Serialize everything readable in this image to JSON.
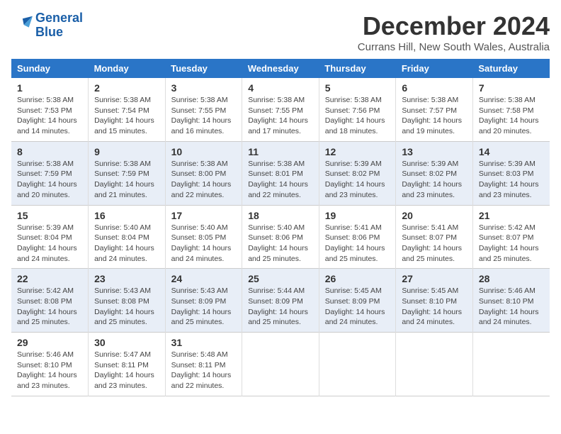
{
  "logo": {
    "line1": "General",
    "line2": "Blue"
  },
  "title": "December 2024",
  "location": "Currans Hill, New South Wales, Australia",
  "weekdays": [
    "Sunday",
    "Monday",
    "Tuesday",
    "Wednesday",
    "Thursday",
    "Friday",
    "Saturday"
  ],
  "weeks": [
    [
      {
        "day": "1",
        "sunrise": "5:38 AM",
        "sunset": "7:53 PM",
        "daylight": "14 hours and 14 minutes."
      },
      {
        "day": "2",
        "sunrise": "5:38 AM",
        "sunset": "7:54 PM",
        "daylight": "14 hours and 15 minutes."
      },
      {
        "day": "3",
        "sunrise": "5:38 AM",
        "sunset": "7:55 PM",
        "daylight": "14 hours and 16 minutes."
      },
      {
        "day": "4",
        "sunrise": "5:38 AM",
        "sunset": "7:55 PM",
        "daylight": "14 hours and 17 minutes."
      },
      {
        "day": "5",
        "sunrise": "5:38 AM",
        "sunset": "7:56 PM",
        "daylight": "14 hours and 18 minutes."
      },
      {
        "day": "6",
        "sunrise": "5:38 AM",
        "sunset": "7:57 PM",
        "daylight": "14 hours and 19 minutes."
      },
      {
        "day": "7",
        "sunrise": "5:38 AM",
        "sunset": "7:58 PM",
        "daylight": "14 hours and 20 minutes."
      }
    ],
    [
      {
        "day": "8",
        "sunrise": "5:38 AM",
        "sunset": "7:59 PM",
        "daylight": "14 hours and 20 minutes."
      },
      {
        "day": "9",
        "sunrise": "5:38 AM",
        "sunset": "7:59 PM",
        "daylight": "14 hours and 21 minutes."
      },
      {
        "day": "10",
        "sunrise": "5:38 AM",
        "sunset": "8:00 PM",
        "daylight": "14 hours and 22 minutes."
      },
      {
        "day": "11",
        "sunrise": "5:38 AM",
        "sunset": "8:01 PM",
        "daylight": "14 hours and 22 minutes."
      },
      {
        "day": "12",
        "sunrise": "5:39 AM",
        "sunset": "8:02 PM",
        "daylight": "14 hours and 23 minutes."
      },
      {
        "day": "13",
        "sunrise": "5:39 AM",
        "sunset": "8:02 PM",
        "daylight": "14 hours and 23 minutes."
      },
      {
        "day": "14",
        "sunrise": "5:39 AM",
        "sunset": "8:03 PM",
        "daylight": "14 hours and 23 minutes."
      }
    ],
    [
      {
        "day": "15",
        "sunrise": "5:39 AM",
        "sunset": "8:04 PM",
        "daylight": "14 hours and 24 minutes."
      },
      {
        "day": "16",
        "sunrise": "5:40 AM",
        "sunset": "8:04 PM",
        "daylight": "14 hours and 24 minutes."
      },
      {
        "day": "17",
        "sunrise": "5:40 AM",
        "sunset": "8:05 PM",
        "daylight": "14 hours and 24 minutes."
      },
      {
        "day": "18",
        "sunrise": "5:40 AM",
        "sunset": "8:06 PM",
        "daylight": "14 hours and 25 minutes."
      },
      {
        "day": "19",
        "sunrise": "5:41 AM",
        "sunset": "8:06 PM",
        "daylight": "14 hours and 25 minutes."
      },
      {
        "day": "20",
        "sunrise": "5:41 AM",
        "sunset": "8:07 PM",
        "daylight": "14 hours and 25 minutes."
      },
      {
        "day": "21",
        "sunrise": "5:42 AM",
        "sunset": "8:07 PM",
        "daylight": "14 hours and 25 minutes."
      }
    ],
    [
      {
        "day": "22",
        "sunrise": "5:42 AM",
        "sunset": "8:08 PM",
        "daylight": "14 hours and 25 minutes."
      },
      {
        "day": "23",
        "sunrise": "5:43 AM",
        "sunset": "8:08 PM",
        "daylight": "14 hours and 25 minutes."
      },
      {
        "day": "24",
        "sunrise": "5:43 AM",
        "sunset": "8:09 PM",
        "daylight": "14 hours and 25 minutes."
      },
      {
        "day": "25",
        "sunrise": "5:44 AM",
        "sunset": "8:09 PM",
        "daylight": "14 hours and 25 minutes."
      },
      {
        "day": "26",
        "sunrise": "5:45 AM",
        "sunset": "8:09 PM",
        "daylight": "14 hours and 24 minutes."
      },
      {
        "day": "27",
        "sunrise": "5:45 AM",
        "sunset": "8:10 PM",
        "daylight": "14 hours and 24 minutes."
      },
      {
        "day": "28",
        "sunrise": "5:46 AM",
        "sunset": "8:10 PM",
        "daylight": "14 hours and 24 minutes."
      }
    ],
    [
      {
        "day": "29",
        "sunrise": "5:46 AM",
        "sunset": "8:10 PM",
        "daylight": "14 hours and 23 minutes."
      },
      {
        "day": "30",
        "sunrise": "5:47 AM",
        "sunset": "8:11 PM",
        "daylight": "14 hours and 23 minutes."
      },
      {
        "day": "31",
        "sunrise": "5:48 AM",
        "sunset": "8:11 PM",
        "daylight": "14 hours and 22 minutes."
      },
      null,
      null,
      null,
      null
    ]
  ],
  "labels": {
    "sunrise": "Sunrise:",
    "sunset": "Sunset:",
    "daylight": "Daylight:"
  }
}
